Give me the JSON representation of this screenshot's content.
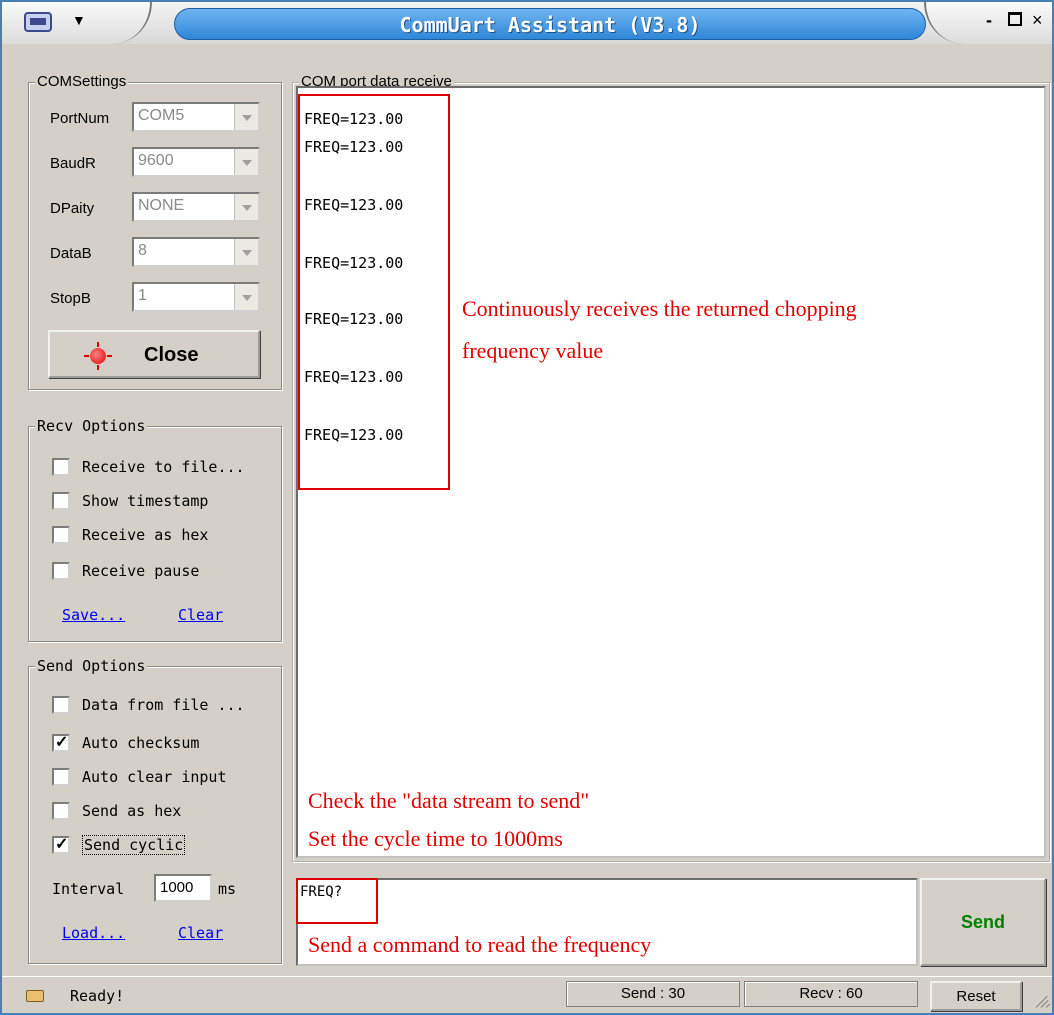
{
  "window": {
    "title": "CommUart Assistant (V3.8)",
    "menu_icon": "serial-port-icon",
    "minimize_label": "-",
    "close_label": "×"
  },
  "com_settings": {
    "legend": "COMSettings",
    "port": {
      "label": "PortNum",
      "value": "COM5"
    },
    "baud": {
      "label": "BaudR",
      "value": "9600"
    },
    "parity": {
      "label": "DPaity",
      "value": "NONE"
    },
    "databits": {
      "label": "DataB",
      "value": "8"
    },
    "stopbits": {
      "label": "StopB",
      "value": "1"
    },
    "close_button": "Close",
    "led_color": "#e00000"
  },
  "recv_options": {
    "legend": "Recv Options",
    "items": [
      {
        "label": "Receive to file...",
        "checked": false
      },
      {
        "label": "Show timestamp",
        "checked": false
      },
      {
        "label": "Receive as hex",
        "checked": false
      },
      {
        "label": "Receive pause",
        "checked": false
      }
    ],
    "save_link": "Save...",
    "clear_link": "Clear"
  },
  "send_options": {
    "legend": "Send Options",
    "items": [
      {
        "label": "Data from file ...",
        "checked": false
      },
      {
        "label": "Auto checksum",
        "checked": true
      },
      {
        "label": "Auto clear input",
        "checked": false
      },
      {
        "label": "Send as hex",
        "checked": false
      },
      {
        "label": "Send cyclic",
        "checked": true
      }
    ],
    "interval_label": "Interval",
    "interval_value": "1000",
    "interval_unit": "ms",
    "load_link": "Load...",
    "clear_link": "Clear"
  },
  "receive": {
    "legend": "COM port data receive",
    "lines": [
      "FREQ=123.00",
      "FREQ=123.00",
      "FREQ=123.00",
      "FREQ=123.00",
      "FREQ=123.00",
      "FREQ=123.00",
      "FREQ=123.00"
    ]
  },
  "send": {
    "input_value": "FREQ?",
    "button_label": "Send",
    "button_color": "#008000"
  },
  "status": {
    "ready_text": "Ready!",
    "send_count": "Send : 30",
    "recv_count": "Recv : 60",
    "reset_label": "Reset"
  },
  "annotations": {
    "recv_note_line1": "Continuously receives the returned chopping",
    "recv_note_line2": "frequency value",
    "cycle_note_line1": "Check the \"data stream to send\"",
    "cycle_note_line2": "Set the cycle time to 1000ms",
    "send_note": "Send a command to read the frequency",
    "color": "#e00000"
  }
}
